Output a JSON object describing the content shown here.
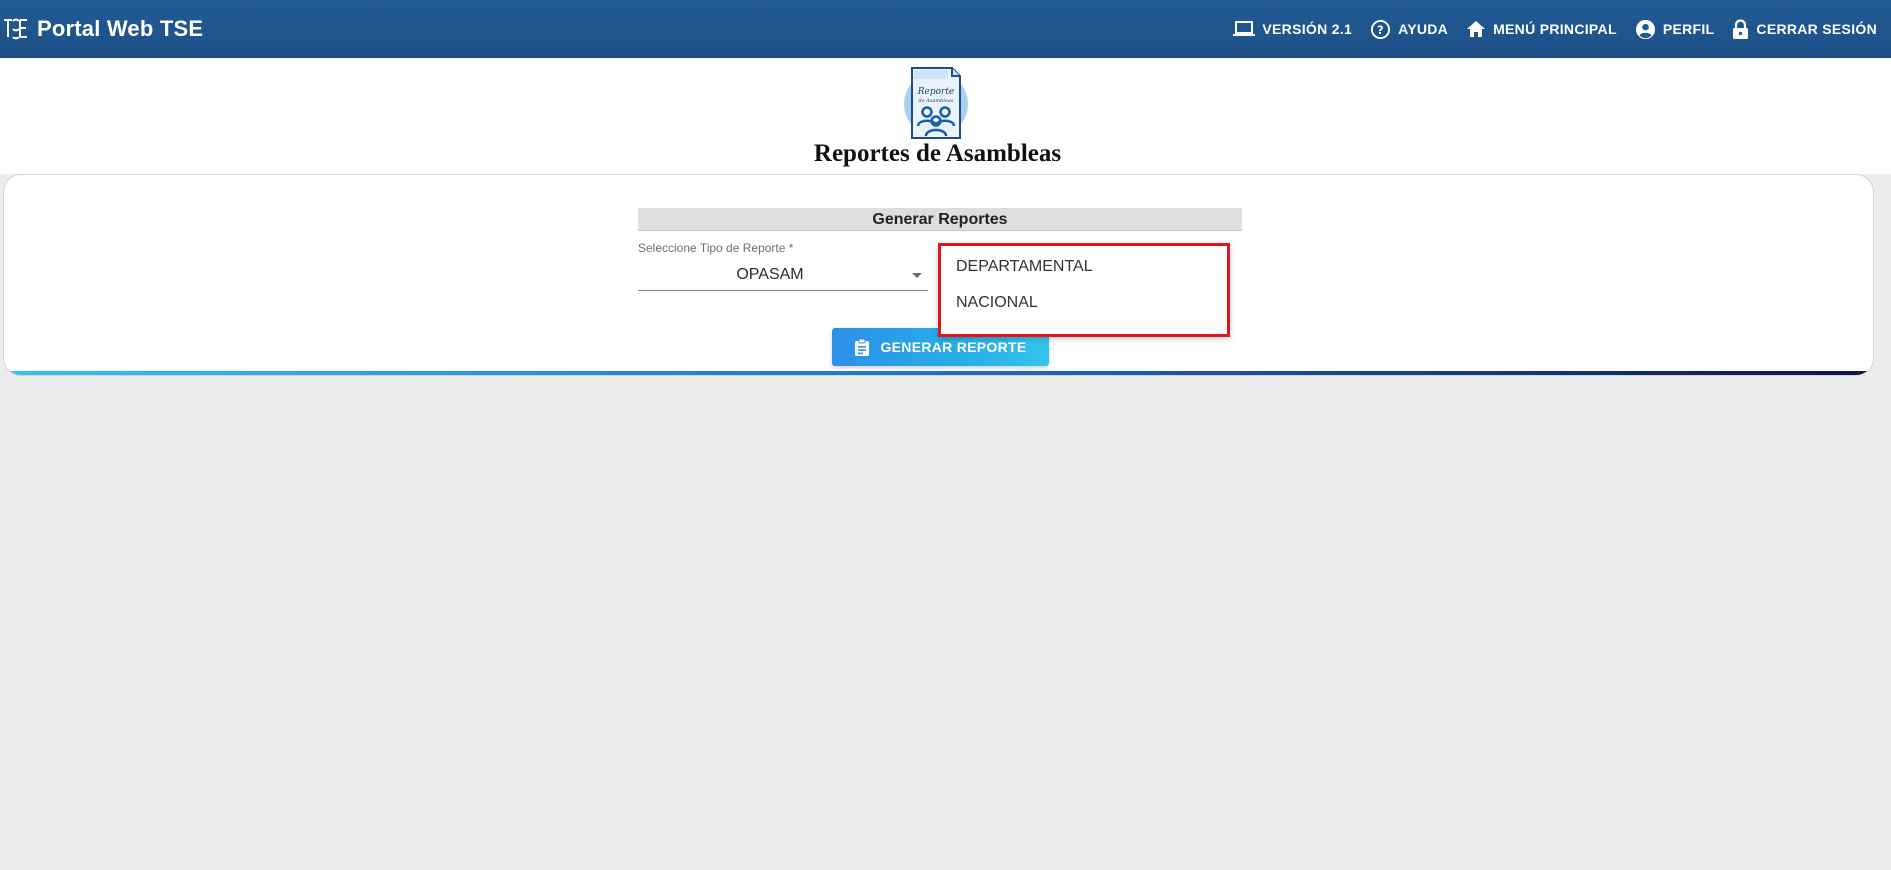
{
  "app": {
    "title": "Portal Web TSE"
  },
  "topnav": {
    "version_label": "VERSIÓN 2.1",
    "help_label": "AYUDA",
    "main_menu_label": "MENÚ PRINCIPAL",
    "profile_label": "PERFIL",
    "logout_label": "CERRAR SESIÓN"
  },
  "header": {
    "title": "Reportes de Asambleas",
    "icon_text_line1": "Reporte",
    "icon_text_line2": "de Asambleas"
  },
  "form": {
    "section_title": "Generar Reportes",
    "report_type": {
      "label": "Seleccione Tipo de Reporte *",
      "value": "OPASAM"
    },
    "dropdown_options": [
      {
        "label": "DEPARTAMENTAL"
      },
      {
        "label": "NACIONAL"
      }
    ],
    "generate_button_label": "GENERAR REPORTE"
  },
  "colors": {
    "topbar": "#235c96",
    "accent_button": "#2d90e8",
    "highlight_border": "#e5151b",
    "background": "#ececec"
  },
  "icons": {
    "brand": "tse-logo-icon",
    "version": "laptop-icon",
    "help": "help-circle-icon",
    "main_menu": "home-icon",
    "profile": "account-circle-icon",
    "logout": "lock-icon",
    "generate": "clipboard-icon"
  }
}
